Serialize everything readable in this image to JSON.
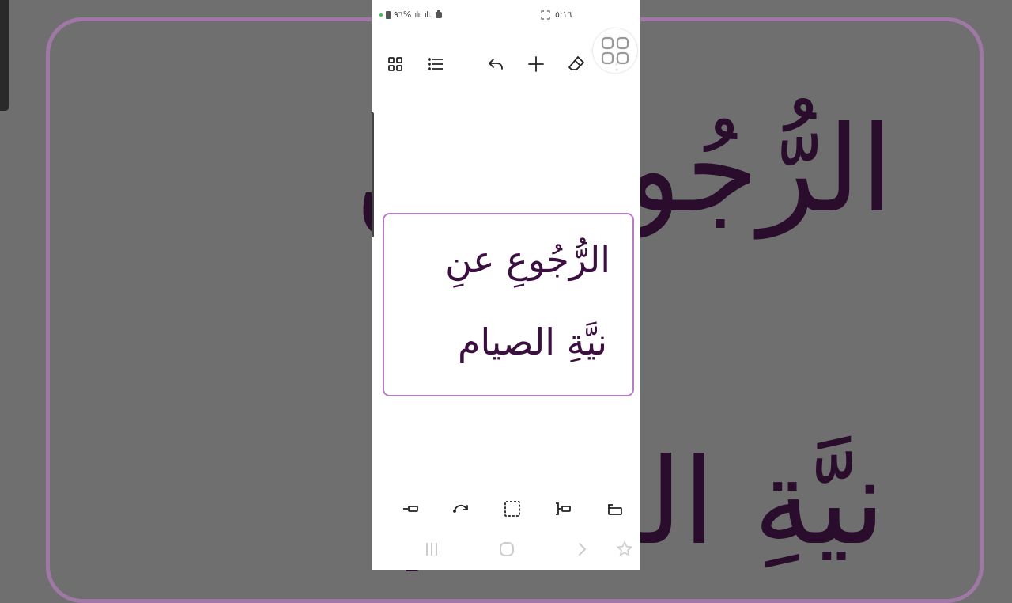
{
  "status_bar": {
    "battery_text": "٩٦%",
    "time": "٥:١٦"
  },
  "card": {
    "line1": "الرُّجُوعِ عنِ",
    "line2": "نيَّةِ الصيام"
  },
  "colors": {
    "card_border": "#b87cc6",
    "card_text": "#3b0f3f",
    "background_dim": "#6f6f6f"
  },
  "toolbar_icons": [
    "grid-view-icon",
    "list-icon",
    "undo-icon",
    "add-icon",
    "eraser-icon",
    "more-vertical-icon"
  ],
  "bottom_tool_icons": [
    "align-left-icon",
    "redo-curve-icon",
    "dashed-select-icon",
    "bracket-box-icon",
    "link-box-icon"
  ],
  "nav_icons": [
    "recent-apps-icon",
    "home-icon",
    "back-icon",
    "accessibility-icon"
  ]
}
